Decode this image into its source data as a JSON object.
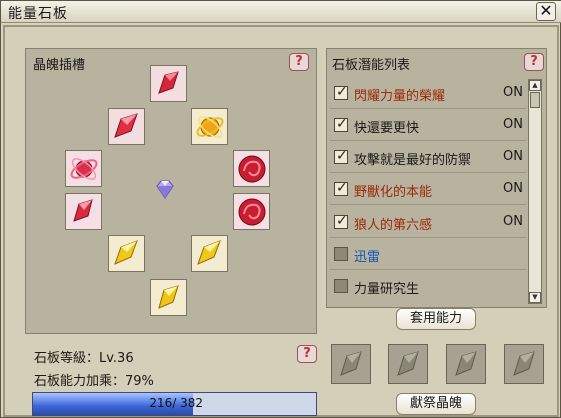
{
  "window": {
    "title": "能量石板",
    "close_label": "✕"
  },
  "slot_panel": {
    "title": "晶魄插槽",
    "help_label": "?"
  },
  "list_panel": {
    "title": "石板潛能列表",
    "help_label": "?",
    "items": [
      {
        "label": "閃耀力量的榮耀",
        "status": "ON",
        "checked": true,
        "color": "orange"
      },
      {
        "label": "快還要更快",
        "status": "ON",
        "checked": true,
        "color": "dark"
      },
      {
        "label": "攻擊就是最好的防禦",
        "status": "ON",
        "checked": true,
        "color": "dark"
      },
      {
        "label": "野獸化的本能",
        "status": "ON",
        "checked": true,
        "color": "orange"
      },
      {
        "label": "狼人的第六感",
        "status": "ON",
        "checked": true,
        "color": "orange"
      },
      {
        "label": "迅雷",
        "status": "",
        "checked": false,
        "color": "blue"
      },
      {
        "label": "力量研究生",
        "status": "",
        "checked": false,
        "color": "dark"
      }
    ],
    "apply_button": "套用能力"
  },
  "stats": {
    "level_label": "石板等級：Lv.36",
    "bonus_label": "石板能力加乘：79%",
    "help_label": "?"
  },
  "progress": {
    "current": 216,
    "max": 382,
    "text": "216/ 382"
  },
  "offer_button": "獻祭晶魄",
  "colors": {
    "accent_red": "#c8283c",
    "accent_yellow": "#e8c020",
    "progress_blue": "#3b66d6"
  },
  "slots": [
    {
      "name": "slot-top",
      "icon": "red-crystal-icon"
    },
    {
      "name": "slot-upper-left",
      "icon": "red-crystal-icon"
    },
    {
      "name": "slot-upper-right",
      "icon": "gold-orbit-icon"
    },
    {
      "name": "slot-left-upper",
      "icon": "pink-orbit-icon"
    },
    {
      "name": "slot-right-upper",
      "icon": "red-swirl-icon"
    },
    {
      "name": "slot-left-lower",
      "icon": "red-sparkle-crystal-icon"
    },
    {
      "name": "slot-right-lower",
      "icon": "red-swirl-icon"
    },
    {
      "name": "slot-lower-left",
      "icon": "yellow-crystal-icon"
    },
    {
      "name": "slot-lower-right",
      "icon": "yellow-crystal-icon"
    },
    {
      "name": "slot-bottom",
      "icon": "yellow-crystal-icon"
    }
  ],
  "equip_slots": [
    "crystal-silhouette-icon",
    "crystal-silhouette-icon",
    "crystal-silhouette-icon",
    "crystal-silhouette-icon"
  ]
}
